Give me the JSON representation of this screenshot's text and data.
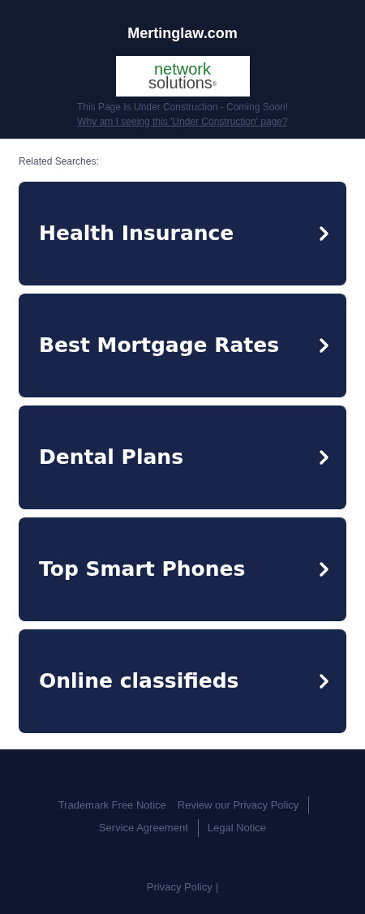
{
  "header": {
    "domain": "Mertinglaw.com",
    "logo": {
      "line_1": "network",
      "line_2": "solutions",
      "mark": "®"
    },
    "notice": "This Page Is Under Construction - Coming Soon!",
    "why_link": "Why am I seeing this 'Under Construction' page?"
  },
  "related": {
    "heading": "Related Searches:",
    "items": [
      {
        "label": "Health Insurance"
      },
      {
        "label": "Best Mortgage Rates"
      },
      {
        "label": "Dental Plans"
      },
      {
        "label": "Top Smart Phones"
      },
      {
        "label": "Online classifieds"
      }
    ]
  },
  "footer": {
    "links": [
      {
        "label": "Trademark Free Notice",
        "divider": false
      },
      {
        "label": "Review our Privacy Policy",
        "divider": true
      },
      {
        "label": "Service Agreement",
        "divider": true
      },
      {
        "label": "Legal Notice",
        "divider": false
      }
    ],
    "bottom_link": "Privacy Policy",
    "bottom_separator": "|"
  }
}
